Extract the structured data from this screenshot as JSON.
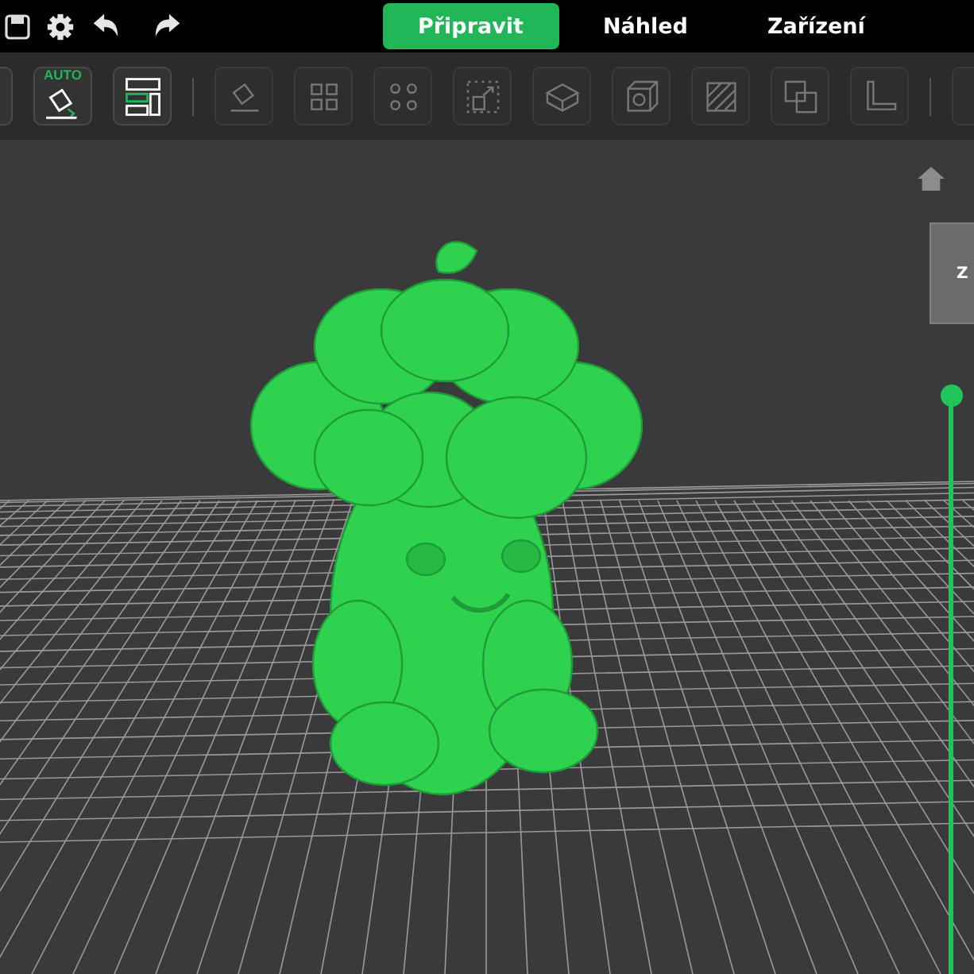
{
  "top_bar": {
    "tabs": [
      {
        "label": "Připravit",
        "selected": true
      },
      {
        "label": "Náhled",
        "selected": false
      },
      {
        "label": "Zařízení",
        "selected": false
      }
    ]
  },
  "toolbar": {
    "items": [
      {
        "kind": "partial",
        "enabled": true
      },
      {
        "kind": "auto-orient",
        "label": "AUTO",
        "enabled": true
      },
      {
        "kind": "arrange",
        "enabled": true
      },
      {
        "kind": "separator"
      },
      {
        "kind": "orient",
        "enabled": false
      },
      {
        "kind": "grid",
        "enabled": false
      },
      {
        "kind": "dots",
        "enabled": false
      },
      {
        "kind": "scale",
        "enabled": false
      },
      {
        "kind": "box",
        "enabled": false
      },
      {
        "kind": "cube",
        "enabled": false
      },
      {
        "kind": "hatch",
        "enabled": false
      },
      {
        "kind": "overlap",
        "enabled": false
      },
      {
        "kind": "corner",
        "enabled": false
      },
      {
        "kind": "separator"
      },
      {
        "kind": "partial",
        "enabled": false
      }
    ]
  },
  "viewport": {
    "view_cube_label": "Z",
    "layer_slider": {
      "level": 1
    }
  }
}
